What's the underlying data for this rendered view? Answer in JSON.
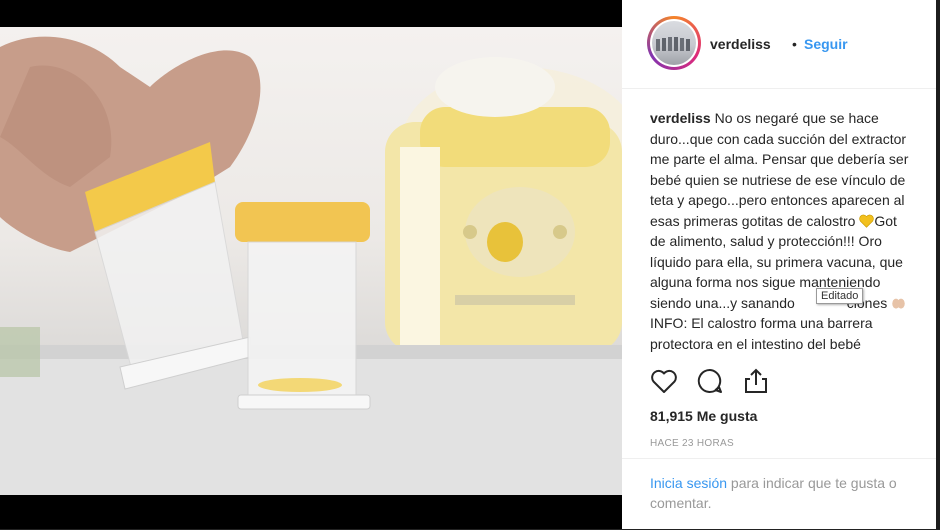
{
  "post": {
    "username": "verdeliss",
    "separator": "•",
    "follow_label": "Seguir",
    "caption_username": "verdeliss",
    "caption_lines": [
      " No os negaré que se hace",
      "duro...que con cada succión del extractor",
      "me parte el alma. Pensar que debería ser",
      "bebé quien se nutriese de ese vínculo de",
      "teta y apego...pero entonces aparecen al",
      "esas primeras gotitas de calostro ",
      "de alimento, salud y protección!!! Oro",
      "líquido para ella, su primera vacuna, que",
      "alguna forma nos sigue manteniendo",
      "siendo una...y sanando",
      "INFO: El calostro forma una barrera",
      "protectora en el intestino del bebé"
    ],
    "caption_line5_tail": "Got",
    "caption_line9_tail": "ciones",
    "tooltip": "Editado",
    "likes": "81,915 Me gusta",
    "time": "HACE 23 HORAS",
    "login_link": "Inicia sesión",
    "login_rest": " para indicar que te gusta o comentar.",
    "icons": {
      "like": "heart-icon",
      "comment": "comment-icon",
      "share": "share-icon",
      "heart_emoji": "yellow-heart-icon",
      "hands_emoji": "hands-icon"
    },
    "colors": {
      "link": "#3897f0",
      "text": "#262626",
      "muted": "#999999",
      "heart_emoji": "#f2c01e"
    }
  }
}
